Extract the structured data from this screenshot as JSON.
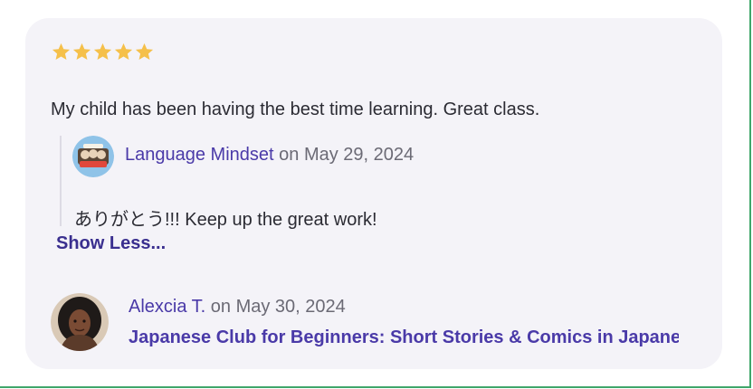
{
  "review": {
    "rating": 5,
    "rating_max": 5,
    "star_color": "#f5c04a",
    "text": "My child has been having the best time learning. Great class."
  },
  "reply": {
    "avatar_icon": "language-mindset-logo",
    "provider_name": "Language Mindset",
    "date_text": " on May 29, 2024",
    "text": "ありがとう!!! Keep up the great work!"
  },
  "show_less_label": "Show Less...",
  "reviewer": {
    "avatar_icon": "user-photo-avatar",
    "name": "Alexcia T.",
    "date_text": " on May 30, 2024",
    "class_title": "Japanese Club for Beginners: Short Stories & Comics in Japanese"
  },
  "colors": {
    "accent": "#4a3aa8",
    "card_bg": "#f4f3f8",
    "frame_border": "#3fa66a"
  }
}
